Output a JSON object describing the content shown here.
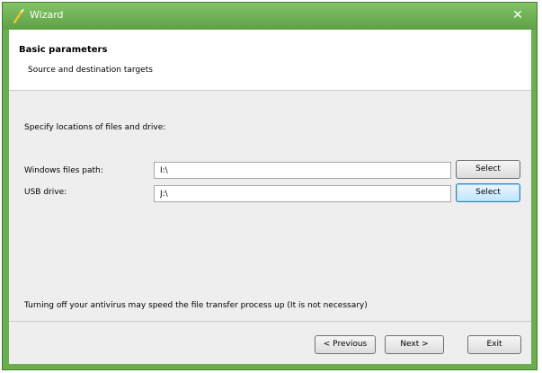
{
  "window": {
    "title": "Wizard",
    "close_glyph": "✕"
  },
  "header": {
    "title": "Basic parameters",
    "subtitle": "Source and destination targets"
  },
  "body": {
    "instruction": "Specify locations of files and drive:",
    "fields": [
      {
        "label": "Windows files path:",
        "value": "I:\\",
        "button": "Select"
      },
      {
        "label": "USB drive:",
        "value": "J:\\",
        "button": "Select"
      }
    ],
    "note": "Turning off your antivirus may speed the file transfer process up (It is not necessary)"
  },
  "footer": {
    "previous_label": "< Previous",
    "next_label": "Next >",
    "exit_label": "Exit"
  },
  "colors": {
    "frame": "#6aae4f",
    "focus_button": "#bee6fd"
  }
}
